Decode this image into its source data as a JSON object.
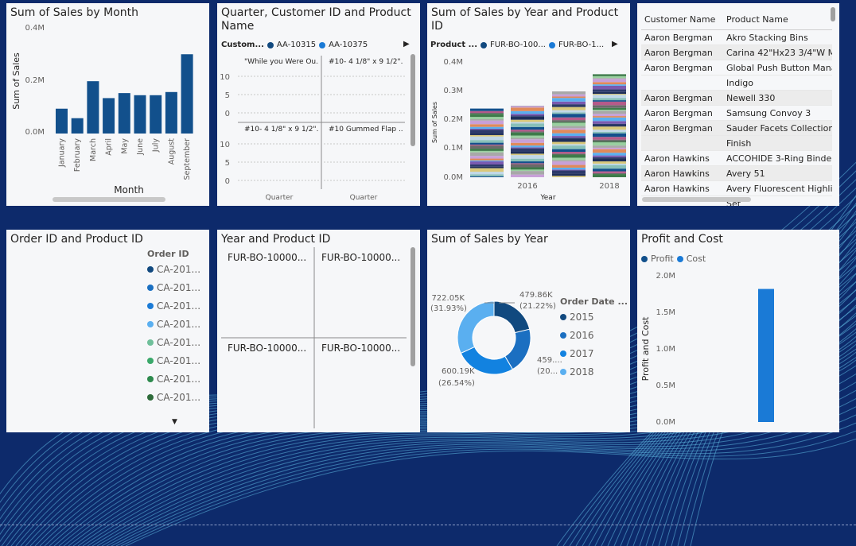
{
  "colors": {
    "bg": "#0d2a6b",
    "bar": "#12508c",
    "donut": [
      "#11497f",
      "#1b6fc1",
      "#1282e0",
      "#5aaff0"
    ],
    "profit": "#12508c",
    "cost": "#1a7ad6"
  },
  "card1": {
    "title": "Sum of Sales by Month",
    "ylabel": "Sum of Sales",
    "xlabel": "Month",
    "yticks": [
      "0.4M",
      "0.2M",
      "0.0M"
    ],
    "chart_data": {
      "type": "bar",
      "categories": [
        "January",
        "February",
        "March",
        "April",
        "May",
        "June",
        "July",
        "August",
        "September"
      ],
      "values": [
        0.094,
        0.058,
        0.198,
        0.134,
        0.153,
        0.145,
        0.145,
        0.157,
        0.3
      ],
      "ylim": [
        0,
        0.4
      ]
    }
  },
  "card2": {
    "title": "Quarter, Customer ID and Product Name",
    "legend_title": "Custom...",
    "legend_items": [
      "AA-10315",
      "AA-10375"
    ],
    "cells": [
      "\"While you Were Ou...",
      "#10- 4 1/8\" x 9 1/2\"...",
      "#10- 4 1/8\" x 9 1/2\"...",
      "#10 Gummed Flap ..."
    ],
    "yticks_top": [
      "10",
      "5",
      "0"
    ],
    "yticks_bottom": [
      "10",
      "5",
      "0"
    ],
    "xlabels": [
      "Quarter",
      "Quarter"
    ]
  },
  "card3": {
    "title": "Sum of Sales by Year and Product ID",
    "legend_title": "Product ...",
    "legend_items": [
      "FUR-BO-100...",
      "FUR-BO-1..."
    ],
    "ylabel": "Sum of Sales",
    "xlabel": "Year",
    "yticks": [
      "0.4M",
      "0.3M",
      "0.2M",
      "0.1M",
      "0.0M"
    ],
    "xticks": [
      "2016",
      "2018"
    ],
    "chart_data": {
      "type": "bar",
      "categories": [
        "2015",
        "2016",
        "2017",
        "2018"
      ],
      "values": [
        0.24,
        0.25,
        0.3,
        0.36
      ],
      "ylim": [
        0,
        0.4
      ]
    }
  },
  "card4": {
    "headers": [
      "Customer Name",
      "Product Name"
    ],
    "rows": [
      [
        "Aaron Bergman",
        "Akro Stacking Bins"
      ],
      [
        "Aaron Bergman",
        "Carina 42\"Hx23 3/4\"W M"
      ],
      [
        "Aaron Bergman",
        "Global Push Button Mana"
      ],
      [
        "",
        "Indigo"
      ],
      [
        "Aaron Bergman",
        "Newell 330"
      ],
      [
        "Aaron Bergman",
        "Samsung Convoy 3"
      ],
      [
        "Aaron Bergman",
        "Sauder Facets Collection"
      ],
      [
        "",
        "Finish"
      ],
      [
        "Aaron Hawkins",
        "ACCOHIDE 3-Ring Binder"
      ],
      [
        "Aaron Hawkins",
        "Avery 51"
      ],
      [
        "Aaron Hawkins",
        "Avery Fluorescent Highlig"
      ],
      [
        "",
        "Set"
      ]
    ]
  },
  "card5": {
    "title": "Order ID and Product ID",
    "legend_title": "Order ID",
    "items": [
      "CA-201...",
      "CA-201...",
      "CA-201...",
      "CA-201...",
      "CA-201...",
      "CA-201...",
      "CA-201...",
      "CA-201..."
    ],
    "item_colors": [
      "#11497f",
      "#1a6fc1",
      "#1a7ad6",
      "#5aaff0",
      "#6fbf9a",
      "#3aa86a",
      "#2d8a4d",
      "#2e6b3a"
    ]
  },
  "card6": {
    "title": "Year and Product ID",
    "cells": [
      "FUR-BO-10000...",
      "FUR-BO-10000...",
      "FUR-BO-10000...",
      "FUR-BO-10000..."
    ]
  },
  "card7": {
    "title": "Sum of Sales by Year",
    "legend_title": "Order Date ...",
    "legend_items": [
      "2015",
      "2016",
      "2017",
      "2018"
    ],
    "labels": {
      "l2018_val": "722.05K",
      "l2018_pct": "(31.93%)",
      "l2015_val": "479.86K",
      "l2015_pct": "(21.22%)",
      "l2016_val": "459....",
      "l2016_pct": "(20...",
      "l2017_val": "600.19K",
      "l2017_pct": "(26.54%)"
    },
    "chart_data": {
      "type": "pie",
      "categories": [
        "2015",
        "2016",
        "2017",
        "2018"
      ],
      "values": [
        479.86,
        459.0,
        600.19,
        722.05
      ],
      "percents": [
        21.22,
        20.31,
        26.54,
        31.93
      ]
    }
  },
  "card8": {
    "title": "Profit and Cost",
    "legend_items": [
      "Profit",
      "Cost"
    ],
    "ylabel": "Profit and Cost",
    "yticks": [
      "2.0M",
      "1.5M",
      "1.0M",
      "0.5M",
      "0.0M"
    ],
    "chart_data": {
      "type": "bar",
      "series": [
        {
          "name": "Profit",
          "values": [
            0
          ]
        },
        {
          "name": "Cost",
          "values": [
            1.82
          ]
        }
      ],
      "ylim": [
        0,
        2.0
      ]
    }
  }
}
